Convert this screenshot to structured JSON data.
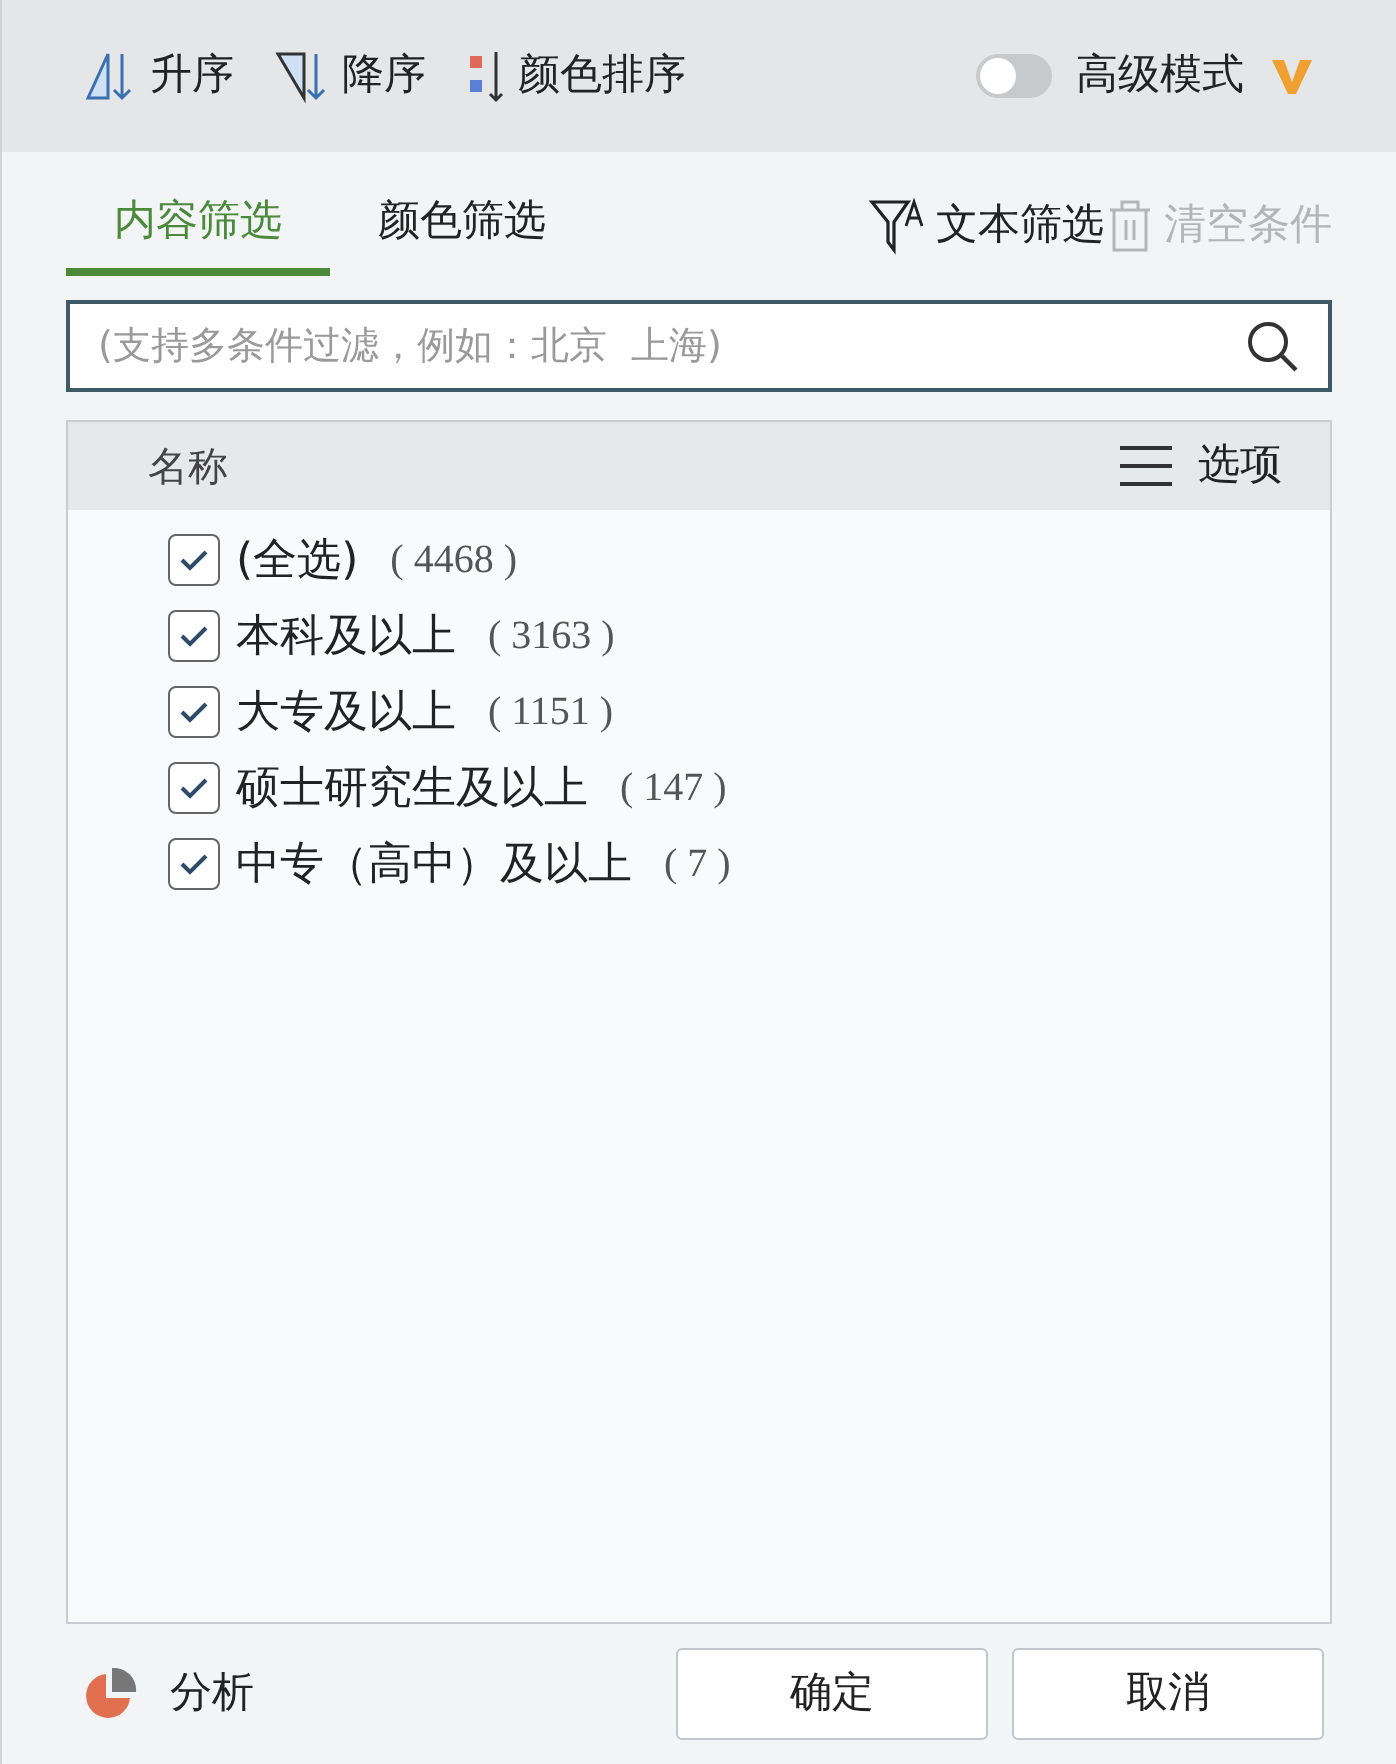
{
  "sort_toolbar": {
    "buttons": [
      {
        "kind": "asc",
        "label": "升序"
      },
      {
        "kind": "desc",
        "label": "降序"
      },
      {
        "kind": "color",
        "label": "颜色排序"
      }
    ],
    "advanced_mode": {
      "label": "高级模式",
      "on": false
    }
  },
  "tabs": [
    {
      "label": "内容筛选",
      "selected": true
    },
    {
      "label": "颜色筛选",
      "selected": false
    }
  ],
  "actions": [
    {
      "kind": "text_filter",
      "label": "文本筛选",
      "disabled": false
    },
    {
      "kind": "clear",
      "label": "清空条件",
      "disabled": true
    }
  ],
  "search": {
    "placeholder": "(支持多条件过滤，例如：北京  上海)"
  },
  "list": {
    "header": "名称",
    "options_label": "选项",
    "items": [
      {
        "label": "(全选)",
        "count": "( 4468 )",
        "checked": true
      },
      {
        "label": "本科及以上",
        "count": "( 3163 )",
        "checked": true
      },
      {
        "label": "大专及以上",
        "count": "( 1151 )",
        "checked": true
      },
      {
        "label": "硕士研究生及以上",
        "count": "( 147 )",
        "checked": true
      },
      {
        "label": "中专（高中）及以上",
        "count": "( 7 )",
        "checked": true
      }
    ]
  },
  "footer": {
    "analysis_label": "分析",
    "buttons": [
      "确定",
      "取消"
    ]
  }
}
